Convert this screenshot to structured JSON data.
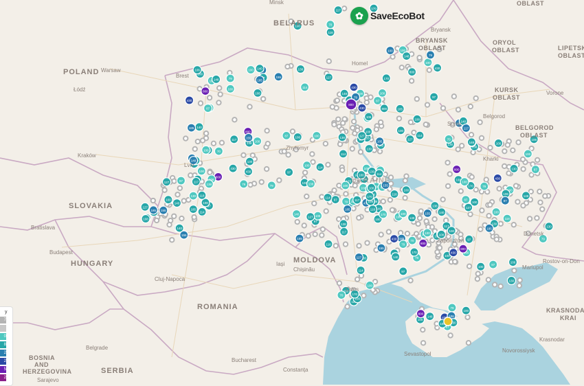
{
  "app": {
    "logo_text": "SaveEcoBot",
    "logo_icon": "leaf-icon"
  },
  "colors": {
    "land": "#f3efe8",
    "sea": "#aad3df",
    "border": "#c9a9c3",
    "road": "#e8d6b8",
    "marker_gray": "#b4b4b4",
    "marker_teal_light": "#4fc8c0",
    "marker_teal": "#27a7a8",
    "marker_blue": "#2a7fb0",
    "marker_navy": "#2b4aa6",
    "marker_purple": "#6a1fb3",
    "marker_yellow": "#e8c42a"
  },
  "legend": {
    "title": "y",
    "rows": [
      {
        "value": "7",
        "color": "#b4b4b4"
      },
      {
        "value": "",
        "color": "#c8c8c8"
      },
      {
        "value": "0",
        "color": "#4fc8c0"
      },
      {
        "value": "8",
        "color": "#27a7a8"
      },
      {
        "value": "2",
        "color": "#2a7fb0"
      },
      {
        "value": "2",
        "color": "#2b4aa6"
      },
      {
        "value": "5",
        "color": "#6a1fb3"
      },
      {
        "value": "2",
        "color": "#8a1f8a"
      }
    ]
  },
  "labels": {
    "countries": [
      "BELARUS",
      "POLAND",
      "SLOVAKIA",
      "HUNGARY",
      "ROMANIA",
      "MOLDOVA",
      "SERBIA",
      "BOSNIA",
      "AND",
      "HERZEGOVINA",
      "UKRAINE"
    ],
    "regions": [
      "BRYANSK",
      "OBLAST",
      "ORYOL",
      "OBLAST",
      "LIPETSK",
      "OBLAST",
      "KURSK",
      "OBLAST",
      "BELGOROD",
      "OBLAST",
      "KRASNODAR",
      "KRAI",
      "OBLAST"
    ],
    "cities": [
      "Minsk",
      "Bryansk",
      "Warsaw",
      "Łódź",
      "Brest",
      "Homel",
      "Vorone",
      "Kraków",
      "Zhytomyr",
      "Sumy",
      "Belgorod",
      "Kharki",
      "Bratislava",
      "Budapest",
      "Cluj-Napoca",
      "Iași",
      "Chișinău",
      "Odes",
      "Zaporizhzh",
      "Donetsk",
      "Rostov-on-Don",
      "Mariupol",
      "Belgrade",
      "Bucharest",
      "Sevastopol",
      "Krasnodar",
      "Novorossiysk",
      "Sarajevo",
      "Constanța",
      "Lviv"
    ]
  },
  "markers": [
    {
      "v": "100",
      "c": "teal_light"
    },
    {
      "v": "170",
      "c": "teal"
    },
    {
      "v": "100",
      "c": "teal_light"
    },
    {
      "v": "100",
      "c": "teal_light"
    },
    {
      "v": "430",
      "c": "navy"
    },
    {
      "v": "800",
      "c": "purple"
    },
    {
      "v": "79",
      "c": "teal_light"
    },
    {
      "v": "148",
      "c": "teal"
    },
    {
      "v": "106",
      "c": "teal"
    },
    {
      "v": "87",
      "c": "teal_light"
    },
    {
      "v": "130",
      "c": "teal"
    },
    {
      "v": "100",
      "c": "teal"
    },
    {
      "v": "114",
      "c": "teal"
    },
    {
      "v": "155",
      "c": "blue"
    },
    {
      "v": "97",
      "c": "teal"
    },
    {
      "v": "138",
      "c": "teal"
    },
    {
      "v": "140",
      "c": "teal"
    },
    {
      "v": "108",
      "c": "teal"
    },
    {
      "v": "127",
      "c": "teal"
    },
    {
      "v": "185",
      "c": "blue"
    },
    {
      "v": "117",
      "c": "teal"
    },
    {
      "v": "118",
      "c": "teal"
    },
    {
      "v": "70",
      "c": "teal_light"
    },
    {
      "v": "100",
      "c": "teal"
    }
  ]
}
